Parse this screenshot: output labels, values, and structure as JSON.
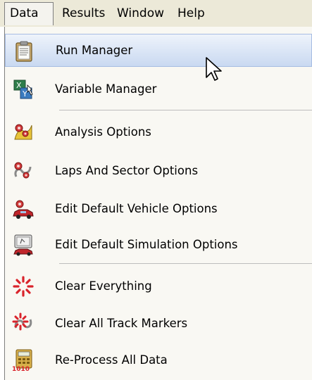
{
  "menubar": {
    "items": [
      "Data",
      "Results",
      "Window",
      "Help"
    ]
  },
  "menu": {
    "items": [
      {
        "label": "Run Manager",
        "icon": "clipboard-icon",
        "highlighted": true
      },
      {
        "label": "Variable Manager",
        "icon": "xy-variable-icon"
      },
      {
        "label": "Analysis Options",
        "icon": "analysis-gears-icon"
      },
      {
        "label": "Laps And Sector Options",
        "icon": "laps-gears-icon"
      },
      {
        "label": "Edit Default Vehicle Options",
        "icon": "vehicle-gear-icon"
      },
      {
        "label": "Edit Default Simulation Options",
        "icon": "simulation-monitor-icon"
      },
      {
        "label": "Clear Everything",
        "icon": "clear-burst-icon"
      },
      {
        "label": "Clear All Track Markers",
        "icon": "clear-markers-icon"
      },
      {
        "label": "Re-Process All Data",
        "icon": "calculator-1010-icon"
      }
    ]
  },
  "colors": {
    "menubar_bg": "#ece9d8",
    "menu_bg": "#f9f8f3",
    "highlight_border": "#a7bde3",
    "highlight_fill": "#c9d9f1"
  }
}
